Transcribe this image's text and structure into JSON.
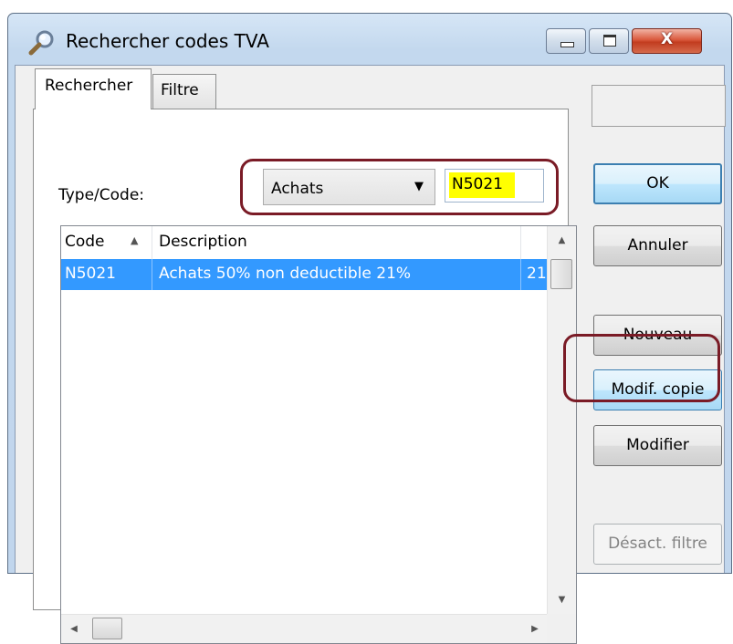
{
  "window": {
    "title": "Rechercher codes TVA",
    "icon": "search-icon",
    "controls": {
      "minimize_icon": "minimize-icon",
      "maximize_icon": "maximize-icon",
      "close_glyph": "X"
    }
  },
  "tabs": [
    {
      "label": "Rechercher",
      "active": true
    },
    {
      "label": "Filtre",
      "active": false
    }
  ],
  "search": {
    "type_code_label": "Type/Code:",
    "type_value": "Achats",
    "code_value": "N5021",
    "code_highlight_color": "#ffff00"
  },
  "list": {
    "columns": {
      "code": "Code",
      "description": "Description"
    },
    "sort_indicator": "▲",
    "rows": [
      {
        "code": "N5021",
        "description": "Achats 50% non deductible 21%",
        "rate": "21",
        "selected": true
      }
    ],
    "selection_color": "#3399ff"
  },
  "buttons": {
    "ok": "OK",
    "cancel": "Annuler",
    "new": "Nouveau",
    "modify_copy": "Modif. copie",
    "modify": "Modifier",
    "disable_filter": "Désact. filtre"
  },
  "annotations": {
    "highlight_color": "#7a1b26"
  }
}
